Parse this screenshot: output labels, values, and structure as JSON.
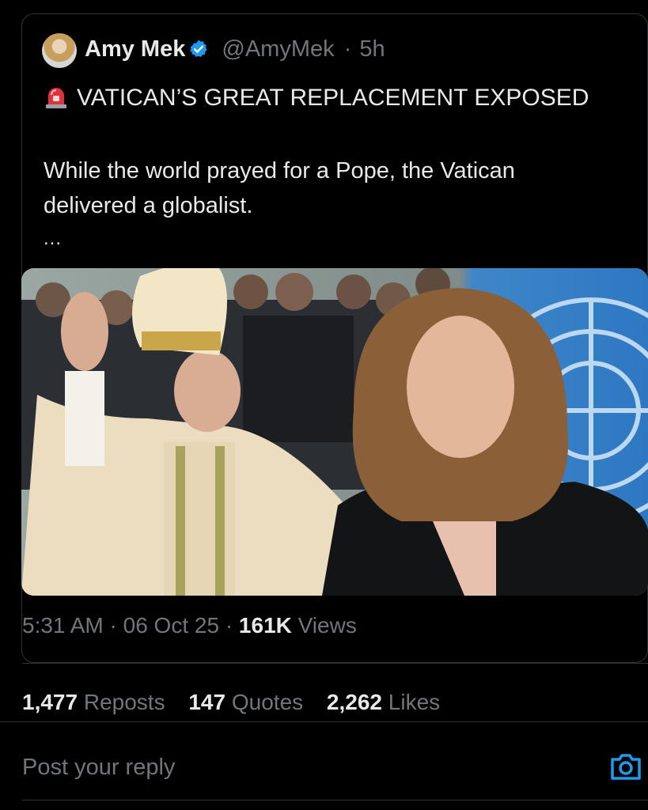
{
  "post": {
    "author_name": "Amy Mek",
    "author_handle": "@AmyMek",
    "age": "5h",
    "headline": "VATICAN’S GREAT REPLACEMENT EXPOSED",
    "body": "While the world prayed for a Pope, the Vatican delivered a globalist.",
    "more": "...",
    "media_alt": "",
    "time": "5:31 AM",
    "date": "06 Oct 25",
    "views_count": "161K",
    "views_label": "Views"
  },
  "stats": [
    {
      "count": "1,477",
      "label": "Reposts"
    },
    {
      "count": "147",
      "label": "Quotes"
    },
    {
      "count": "2,262",
      "label": "Likes"
    }
  ],
  "reply": {
    "placeholder": "Post your reply"
  },
  "icons": {
    "verified": "verified-badge-icon",
    "headline": "siren-icon",
    "media_attach": "camera-icon"
  },
  "colors": {
    "background": "#000000",
    "text": "#e7e9ea",
    "muted": "#71767b",
    "divider": "#2f3336",
    "accent": "#1d9bf0"
  }
}
